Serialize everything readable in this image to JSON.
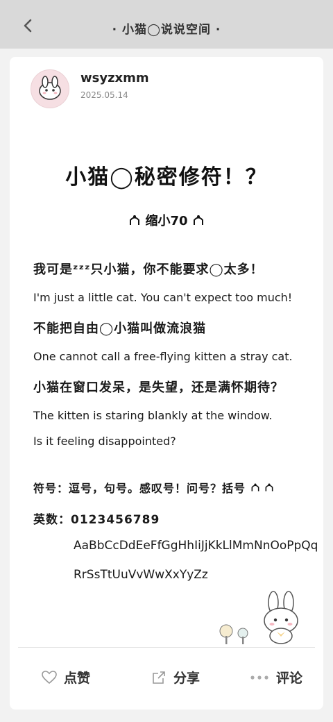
{
  "header": {
    "back_icon": "chevron-left-icon",
    "title": "· 小猫◯说说空间 ·"
  },
  "post": {
    "author": "wsyzxmm",
    "date": "2025.05.14",
    "title": "小猫◯秘密修符！？",
    "subtitle": "缩小70",
    "lines": [
      "我可是ᶻᶻᶻ只小猫，你不能要求◯太多！",
      "I'm just a little cat. You can't expect too much!",
      "不能把自由◯小猫叫做流浪猫",
      "One cannot call a free-flying kitten a stray cat.",
      "小猫在窗口发呆，是失望，还是满怀期待？",
      "The kitten is staring blankly at the window.",
      "Is it feeling disappointed?",
      "符号：逗号，句号。感叹号！问号？括号",
      "英数：0123456789",
      "AaBbCcDdEeFfGgHhIiJjKkLlMmNnOoPpQq",
      "RrSsTtUuVvWwXxYyZz"
    ]
  },
  "actions": {
    "like": "点赞",
    "share": "分享",
    "comment": "评论"
  },
  "colors": {
    "topbar": "#d9d9d9",
    "background": "#f2f2f2",
    "card": "#ffffff",
    "avatar_bg": "#f6dfe3"
  }
}
